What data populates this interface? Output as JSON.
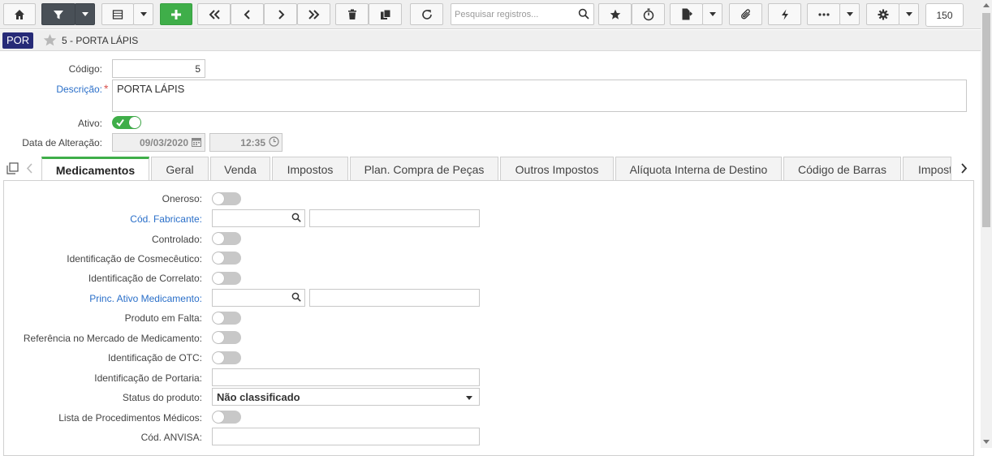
{
  "toolbar": {
    "search_placeholder": "Pesquisar registros...",
    "page_size": "150"
  },
  "header": {
    "entity_badge": "POR",
    "title": "5 - PORTA LÁPIS"
  },
  "form": {
    "codigo": {
      "label": "Código:",
      "value": "5"
    },
    "descricao": {
      "label": "Descrição:",
      "value": "PORTA LÁPIS",
      "required_mark": "*"
    },
    "ativo": {
      "label": "Ativo:",
      "on": true
    },
    "data_alteracao": {
      "label": "Data de Alteração:",
      "date": "09/03/2020",
      "time": "12:35"
    }
  },
  "tabs": [
    {
      "label": "Medicamentos",
      "active": true
    },
    {
      "label": "Geral"
    },
    {
      "label": "Venda"
    },
    {
      "label": "Impostos"
    },
    {
      "label": "Plan. Compra de Peças"
    },
    {
      "label": "Outros Impostos"
    },
    {
      "label": "Alíquota Interna de Destino"
    },
    {
      "label": "Código de Barras"
    },
    {
      "label": "Impost"
    }
  ],
  "medicamentos": {
    "oneroso": "Oneroso:",
    "cod_fabricante": "Cód. Fabricante:",
    "controlado": "Controlado:",
    "cosmeceutico": "Identificação de Cosmecêutico:",
    "correlato": "Identificação de Correlato:",
    "princ_ativo": "Princ. Ativo Medicamento:",
    "produto_falta": "Produto em Falta:",
    "ref_mercado": "Referência no Mercado de Medicamento:",
    "otc": "Identificação de OTC:",
    "portaria": "Identificação de Portaria:",
    "status_label": "Status do produto:",
    "status_value": "Não classificado",
    "procedimentos": "Lista de Procedimentos Médicos:",
    "anvisa": "Cód. ANVISA:"
  },
  "colors": {
    "accent_green": "#3fae49",
    "badge_navy": "#262a77",
    "link_blue": "#2a6fc9"
  }
}
